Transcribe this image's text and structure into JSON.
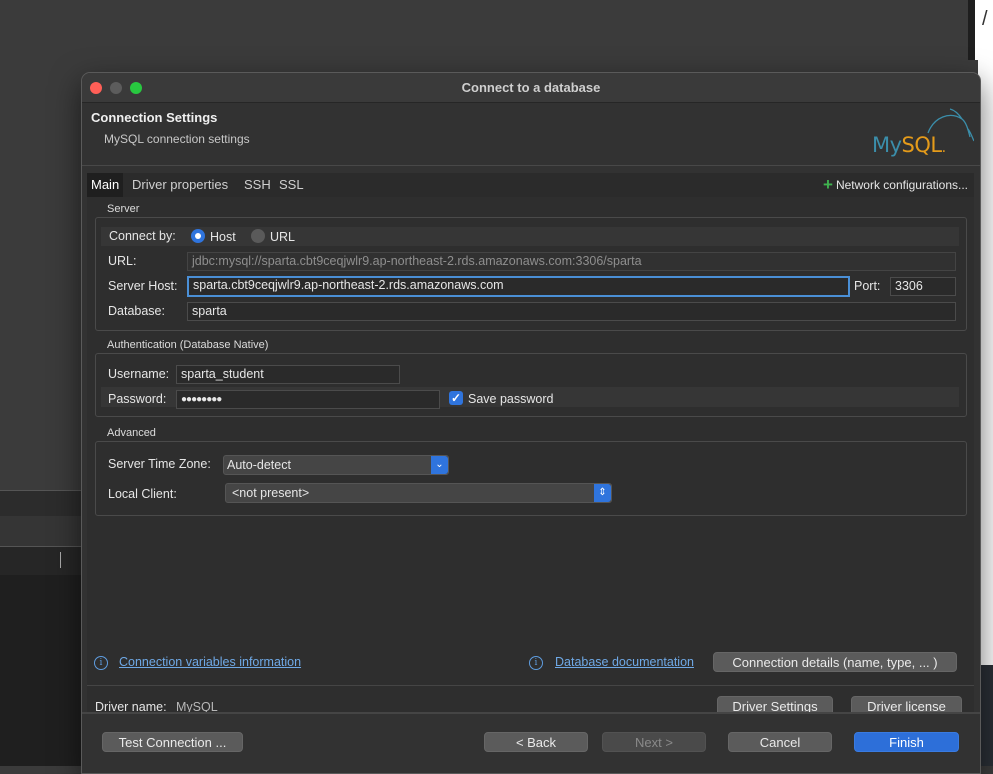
{
  "window": {
    "title": "Connect to a database"
  },
  "header": {
    "title": "Connection Settings",
    "subtitle": "MySQL connection settings",
    "logo_my": "My",
    "logo_sql": "SQL",
    "logo_dot": "."
  },
  "tabs": [
    {
      "label": "Main",
      "active": true
    },
    {
      "label": "Driver properties",
      "active": false
    },
    {
      "label": "SSH",
      "active": false
    },
    {
      "label": "SSL",
      "active": false
    }
  ],
  "network_config": {
    "icon": "plus-icon",
    "label": "Network configurations..."
  },
  "server": {
    "legend": "Server",
    "connect_by_label": "Connect by:",
    "option_host": "Host",
    "option_url": "URL",
    "selected": "Host",
    "url_label": "URL:",
    "url_value": "jdbc:mysql://sparta.cbt9ceqjwlr9.ap-northeast-2.rds.amazonaws.com:3306/sparta",
    "host_label": "Server Host:",
    "host_value": "sparta.cbt9ceqjwlr9.ap-northeast-2.rds.amazonaws.com",
    "port_label": "Port:",
    "port_value": "3306",
    "database_label": "Database:",
    "database_value": "sparta"
  },
  "auth": {
    "legend": "Authentication (Database Native)",
    "username_label": "Username:",
    "username_value": "sparta_student",
    "password_label": "Password:",
    "password_value": "●●●●●●●●",
    "save_password_label": "Save password",
    "save_password_checked": true
  },
  "advanced": {
    "legend": "Advanced",
    "timezone_label": "Server Time Zone:",
    "timezone_value": "Auto-detect",
    "local_client_label": "Local Client:",
    "local_client_value": "<not present>"
  },
  "links": {
    "conn_vars": "Connection variables information",
    "db_docs": "Database documentation",
    "conn_details": "Connection details (name, type, ... )"
  },
  "driver": {
    "label": "Driver name:",
    "value": "MySQL",
    "settings_btn": "Driver Settings",
    "license_btn": "Driver license"
  },
  "footer": {
    "test": "Test Connection ...",
    "back": "< Back",
    "next": "Next >",
    "cancel": "Cancel",
    "finish": "Finish"
  },
  "colors": {
    "accent": "#2f74dd",
    "link": "#6fa9e6",
    "dialog_bg": "#323232"
  },
  "background": {
    "slash": "/"
  }
}
